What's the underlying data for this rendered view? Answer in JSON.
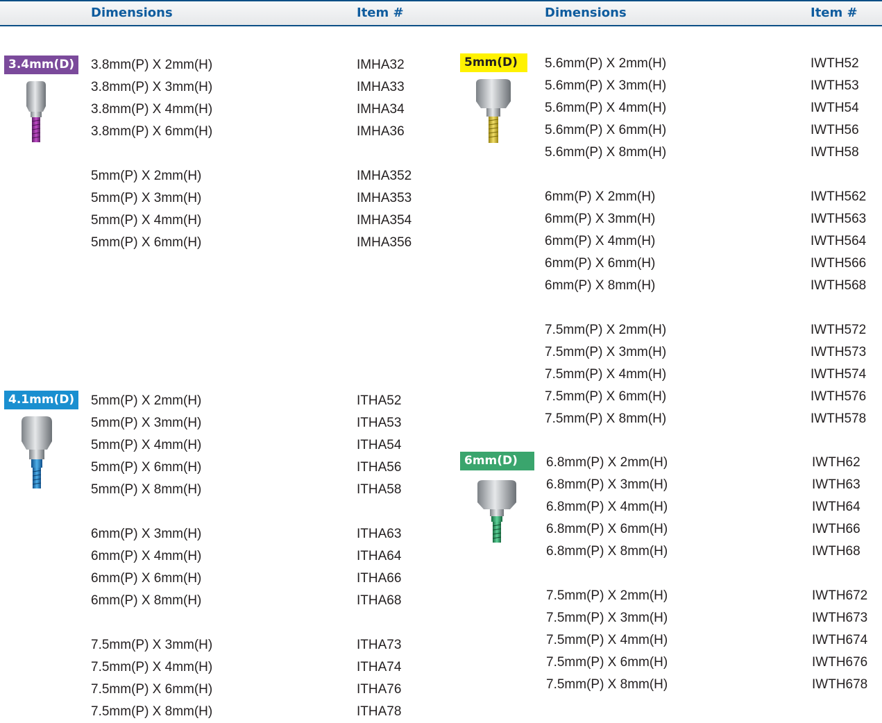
{
  "header": {
    "left_dimensions": "Dimensions",
    "left_item": "Item #",
    "right_dimensions": "Dimensions",
    "right_item": "Item #"
  },
  "colors": {
    "header_text": "#0f5c9e",
    "header_rule": "#0b4f86",
    "badge_34": "#7b4a9b",
    "badge_41": "#1a8fd0",
    "badge_5": "#fff200",
    "badge_6": "#3aa56d"
  },
  "sections": {
    "s34": {
      "badge": "3.4mm(D)",
      "icon": "healing-abutment-purple",
      "groups": [
        [
          [
            "3.8mm(P) X 2mm(H)",
            "IMHA32"
          ],
          [
            "3.8mm(P) X 3mm(H)",
            "IMHA33"
          ],
          [
            "3.8mm(P) X 4mm(H)",
            "IMHA34"
          ],
          [
            "3.8mm(P) X 6mm(H)",
            "IMHA36"
          ]
        ],
        [
          [
            "5mm(P) X 2mm(H)",
            "IMHA352"
          ],
          [
            "5mm(P) X 3mm(H)",
            "IMHA353"
          ],
          [
            "5mm(P) X 4mm(H)",
            "IMHA354"
          ],
          [
            "5mm(P) X 6mm(H)",
            "IMHA356"
          ]
        ]
      ]
    },
    "s41": {
      "badge": "4.1mm(D)",
      "icon": "healing-abutment-blue",
      "groups": [
        [
          [
            "5mm(P) X 2mm(H)",
            "ITHA52"
          ],
          [
            "5mm(P) X 3mm(H)",
            "ITHA53"
          ],
          [
            "5mm(P) X 4mm(H)",
            "ITHA54"
          ],
          [
            "5mm(P) X 6mm(H)",
            "ITHA56"
          ],
          [
            "5mm(P) X 8mm(H)",
            "ITHA58"
          ]
        ],
        [
          [
            "6mm(P) X 3mm(H)",
            "ITHA63"
          ],
          [
            "6mm(P) X 4mm(H)",
            "ITHA64"
          ],
          [
            "6mm(P) X 6mm(H)",
            "ITHA66"
          ],
          [
            "6mm(P) X 8mm(H)",
            "ITHA68"
          ]
        ],
        [
          [
            "7.5mm(P) X 3mm(H)",
            "ITHA73"
          ],
          [
            "7.5mm(P) X 4mm(H)",
            "ITHA74"
          ],
          [
            "7.5mm(P) X 6mm(H)",
            "ITHA76"
          ],
          [
            "7.5mm(P) X 8mm(H)",
            "ITHA78"
          ]
        ]
      ]
    },
    "s5": {
      "badge": "5mm(D)",
      "icon": "healing-abutment-yellow",
      "groups": [
        [
          [
            "5.6mm(P) X 2mm(H)",
            "IWTH52"
          ],
          [
            "5.6mm(P) X 3mm(H)",
            "IWTH53"
          ],
          [
            "5.6mm(P) X 4mm(H)",
            "IWTH54"
          ],
          [
            "5.6mm(P) X 6mm(H)",
            "IWTH56"
          ],
          [
            "5.6mm(P) X 8mm(H)",
            "IWTH58"
          ]
        ],
        [
          [
            "6mm(P) X 2mm(H)",
            "IWTH562"
          ],
          [
            "6mm(P) X 3mm(H)",
            "IWTH563"
          ],
          [
            "6mm(P) X 4mm(H)",
            "IWTH564"
          ],
          [
            "6mm(P) X 6mm(H)",
            "IWTH566"
          ],
          [
            "6mm(P) X 8mm(H)",
            "IWTH568"
          ]
        ],
        [
          [
            "7.5mm(P) X 2mm(H)",
            "IWTH572"
          ],
          [
            "7.5mm(P) X 3mm(H)",
            "IWTH573"
          ],
          [
            "7.5mm(P) X 4mm(H)",
            "IWTH574"
          ],
          [
            "7.5mm(P) X 6mm(H)",
            "IWTH576"
          ],
          [
            "7.5mm(P) X 8mm(H)",
            "IWTH578"
          ]
        ]
      ]
    },
    "s6": {
      "badge": "6mm(D)",
      "icon": "healing-abutment-green",
      "groups": [
        [
          [
            "6.8mm(P) X 2mm(H)",
            "IWTH62"
          ],
          [
            "6.8mm(P) X 3mm(H)",
            "IWTH63"
          ],
          [
            "6.8mm(P) X 4mm(H)",
            "IWTH64"
          ],
          [
            "6.8mm(P) X 6mm(H)",
            "IWTH66"
          ],
          [
            "6.8mm(P) X 8mm(H)",
            "IWTH68"
          ]
        ],
        [
          [
            "7.5mm(P) X 2mm(H)",
            "IWTH672"
          ],
          [
            "7.5mm(P) X 3mm(H)",
            "IWTH673"
          ],
          [
            "7.5mm(P) X 4mm(H)",
            "IWTH674"
          ],
          [
            "7.5mm(P) X 6mm(H)",
            "IWTH676"
          ],
          [
            "7.5mm(P) X 8mm(H)",
            "IWTH678"
          ]
        ]
      ]
    }
  }
}
